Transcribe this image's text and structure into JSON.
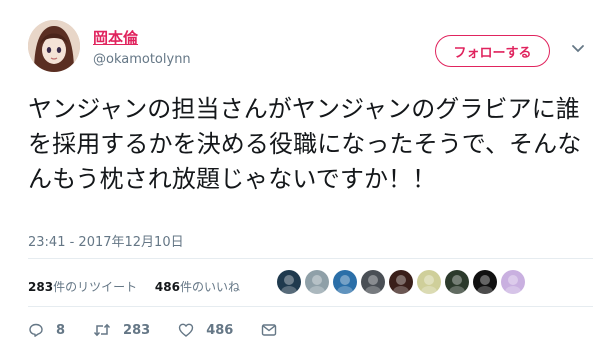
{
  "user": {
    "display_name": "岡本倫",
    "handle": "@okamotolynn",
    "follow_label": "フォローする"
  },
  "tweet": {
    "text": "ヤンジャンの担当さんがヤンジャンのグラビアに誰を採用するかを決める役職になったそうで、そんなんもう枕され放題じゃないですか！！",
    "timestamp": "23:41 - 2017年12月10日"
  },
  "stats": {
    "retweets": {
      "count": "283",
      "label": "件のリツイート"
    },
    "likes": {
      "count": "486",
      "label": "件のいいね"
    }
  },
  "liker_avatars": [
    "#1f3a4e",
    "#8fa0a8",
    "#2b6fa8",
    "#4a4f55",
    "#3a1f1a",
    "#cfcf9a",
    "#2c3a2c",
    "#111111",
    "#c9b0e0"
  ],
  "actions": {
    "reply_count": "8",
    "retweet_count": "283",
    "like_count": "486"
  },
  "colors": {
    "accent": "#e0245e",
    "muted": "#657786",
    "text": "#14171a",
    "divider": "#e6ecf0"
  },
  "icons": [
    "chevron-down-icon",
    "reply-icon",
    "retweet-icon",
    "heart-icon",
    "message-icon"
  ]
}
